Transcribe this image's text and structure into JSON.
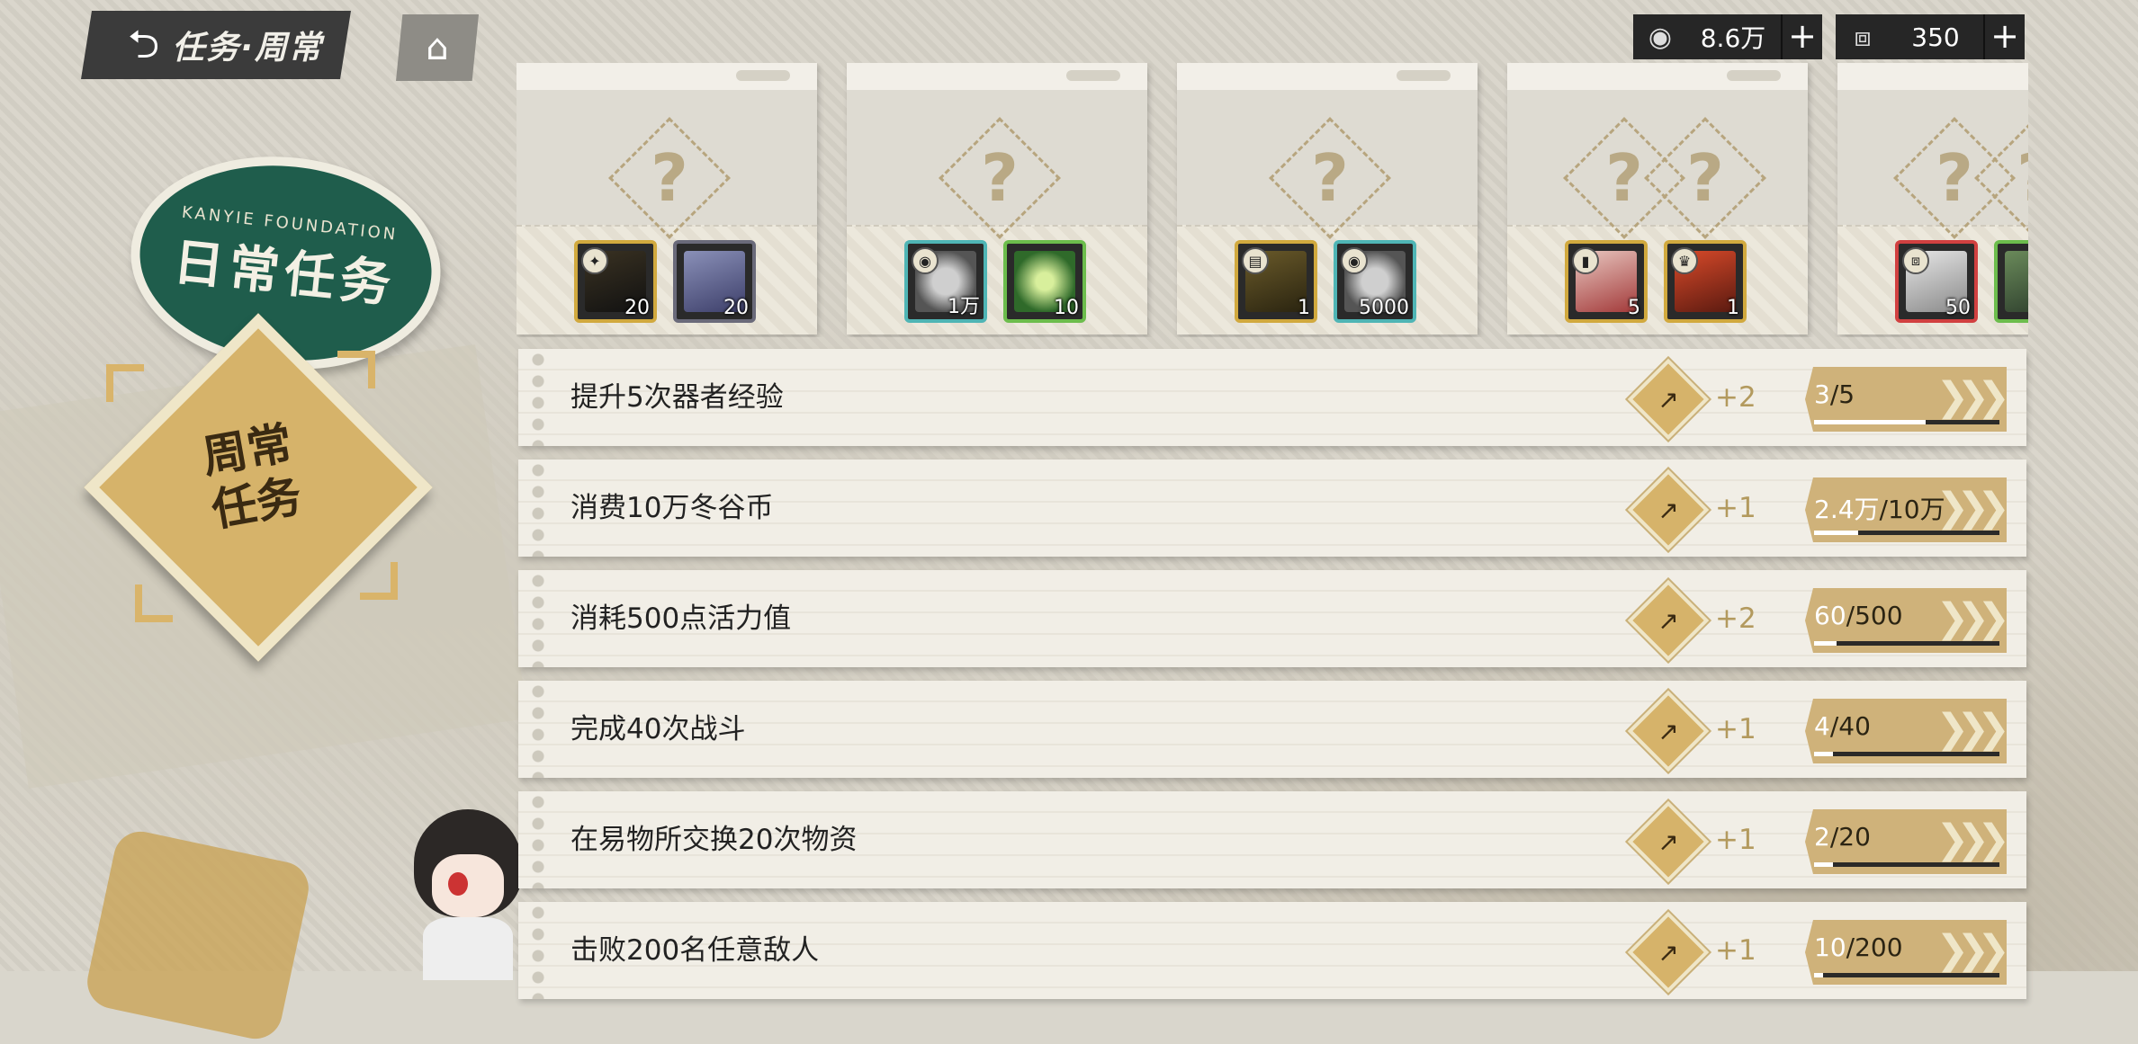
{
  "header": {
    "back_title": "任务·周常",
    "back_icon": "back-arrow-icon",
    "home_icon": "home-icon"
  },
  "currencies": [
    {
      "icon": "coin-icon",
      "value": "8.6万",
      "plus": "+"
    },
    {
      "icon": "ticket-icon",
      "value": "350",
      "plus": "+"
    }
  ],
  "left_panel": {
    "daily_arc": "KANYIE FOUNDATION",
    "daily_label": "日常任务",
    "weekly_label_line1": "周常",
    "weekly_label_line2": "任务"
  },
  "reward_cards": [
    {
      "mystery": "?",
      "items": [
        {
          "count": "20",
          "tier": "gold"
        },
        {
          "count": "20",
          "tier": "dark"
        }
      ]
    },
    {
      "mystery": "?",
      "items": [
        {
          "count": "1万",
          "tier": "teal"
        },
        {
          "count": "10",
          "tier": "green"
        }
      ]
    },
    {
      "mystery": "?",
      "items": [
        {
          "count": "1",
          "tier": "gold"
        },
        {
          "count": "5000",
          "tier": "teal"
        }
      ]
    },
    {
      "mystery": "?",
      "items": [
        {
          "count": "5",
          "tier": "gold"
        },
        {
          "count": "1",
          "tier": "gold"
        }
      ]
    },
    {
      "mystery": "?",
      "items": [
        {
          "count": "50",
          "tier": "red"
        },
        {
          "count": "",
          "tier": "green"
        }
      ]
    }
  ],
  "tasks": [
    {
      "name": "提升5次器者经验",
      "points": "+2",
      "current": "3",
      "total": "/5",
      "progress": 0.6
    },
    {
      "name": "消费10万冬谷币",
      "points": "+1",
      "current": "2.4万",
      "total": "/10万",
      "progress": 0.24
    },
    {
      "name": "消耗500点活力值",
      "points": "+2",
      "current": "60",
      "total": "/500",
      "progress": 0.12
    },
    {
      "name": "完成40次战斗",
      "points": "+1",
      "current": "4",
      "total": "/40",
      "progress": 0.1
    },
    {
      "name": "在易物所交换20次物资",
      "points": "+1",
      "current": "2",
      "total": "/20",
      "progress": 0.1
    },
    {
      "name": "击败200名任意敌人",
      "points": "+1",
      "current": "10",
      "total": "/200",
      "progress": 0.05
    }
  ]
}
